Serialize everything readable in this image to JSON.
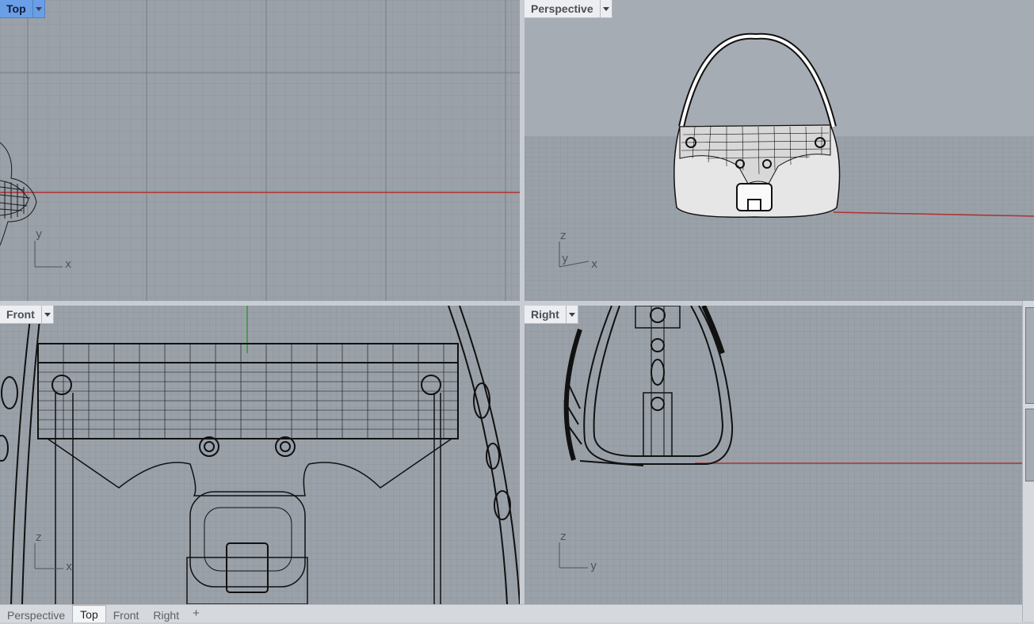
{
  "viewports": {
    "top": {
      "title": "Top",
      "axis_x": "x",
      "axis_y": "y",
      "active": true
    },
    "perspective": {
      "title": "Perspective",
      "axis_x": "x",
      "axis_y": "y",
      "axis_z": "z"
    },
    "front": {
      "title": "Front",
      "axis_x": "x",
      "axis_z": "z"
    },
    "right": {
      "title": "Right",
      "axis_y": "y",
      "axis_z": "z"
    }
  },
  "tabs": [
    {
      "label": "Perspective",
      "active": false
    },
    {
      "label": "Top",
      "active": true
    },
    {
      "label": "Front",
      "active": false
    },
    {
      "label": "Right",
      "active": false
    }
  ],
  "add_tab_icon": "plus-icon",
  "colors": {
    "viewport_bg": "#9aa1a9",
    "grid_minor": "#8c939b",
    "grid_major": "#7b828a",
    "x_axis": "#b03030",
    "z_axis": "#2f9a2f",
    "active_label": "#6a9ee6"
  }
}
